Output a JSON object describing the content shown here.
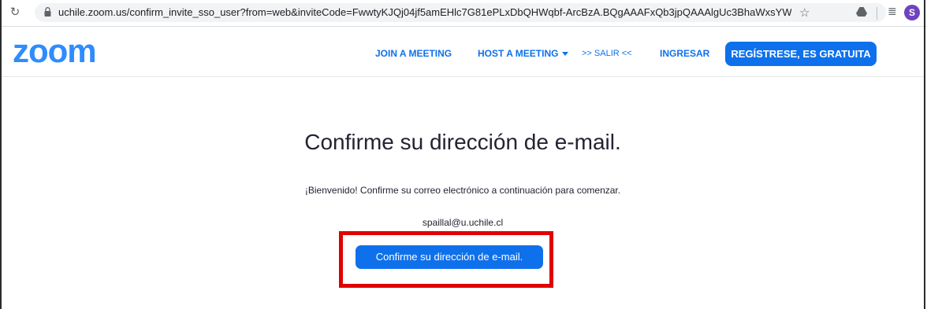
{
  "browser": {
    "url": "uchile.zoom.us/confirm_invite_sso_user?from=web&inviteCode=FwwtyKJQj04jf5amEHlc7G81ePLxDbQHWqbf-ArcBzA.BQgAAAFxQb3jpQAAAlgUc3BhaWxsYWxAdS51...",
    "profile_initial": "S"
  },
  "header": {
    "logo": "zoom",
    "nav": {
      "join": "JOIN A MEETING",
      "host": "HOST A MEETING",
      "salir": ">> SALIR <<",
      "ingresar": "INGRESAR",
      "signup": "REGÍSTRESE, ES GRATUITA"
    }
  },
  "main": {
    "title": "Confirme su dirección de e-mail.",
    "welcome": "¡Bienvenido! Confirme su correo electrónico a continuación para comenzar.",
    "email": "spaillal@u.uchile.cl",
    "confirm_button": "Confirme su dirección de e-mail."
  },
  "colors": {
    "brand_blue": "#2d8cff",
    "button_blue": "#0e71eb",
    "highlight_red": "#e00000"
  }
}
